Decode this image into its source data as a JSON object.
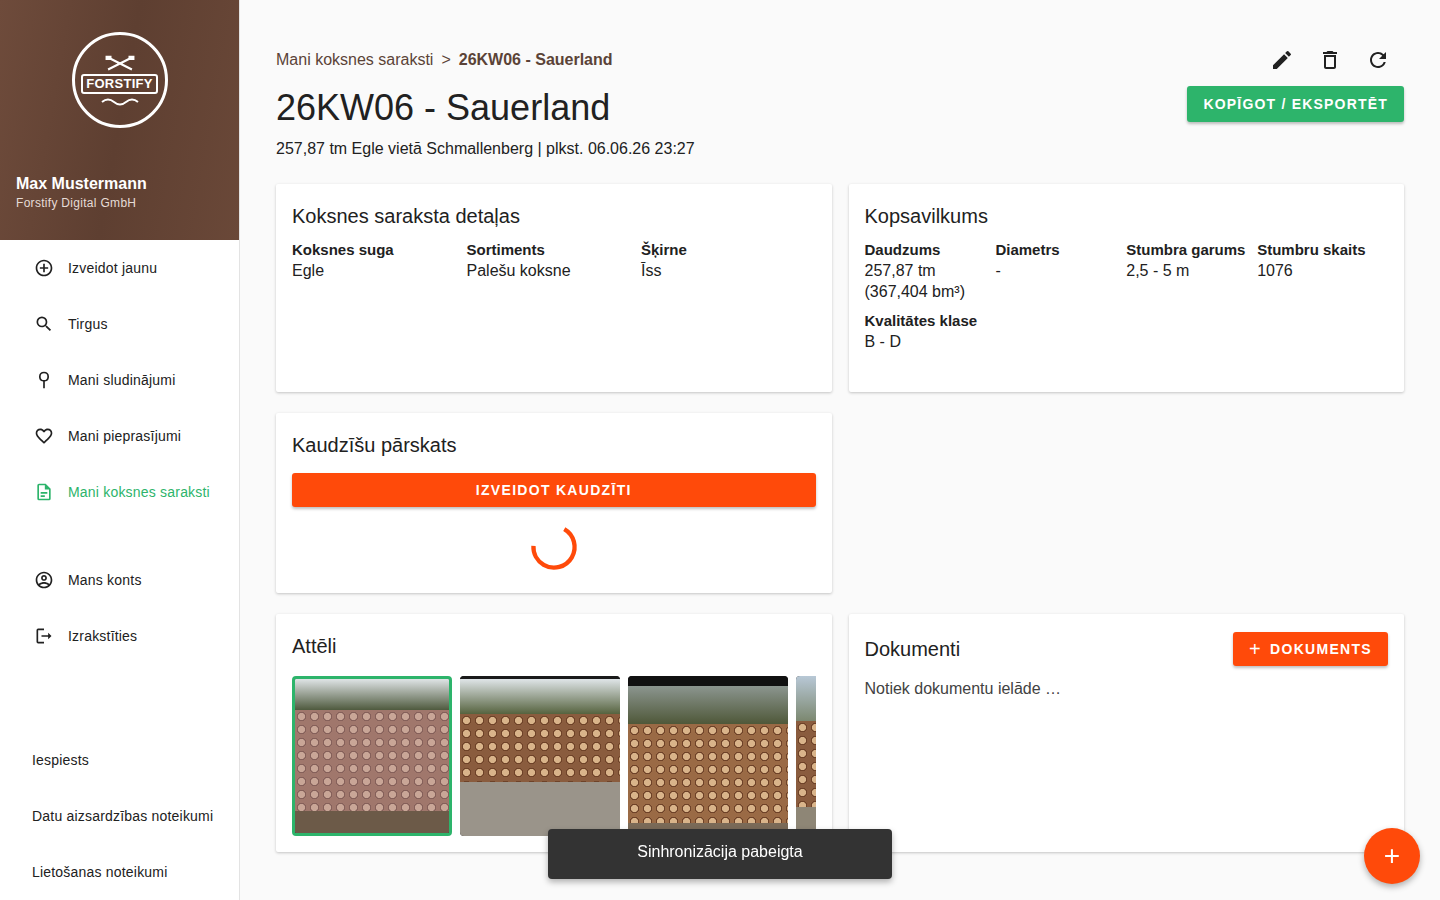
{
  "sidebar": {
    "logo": "FORSTIFY",
    "user": "Max Mustermann",
    "company": "Forstify Digital GmbH",
    "nav": [
      {
        "label": "Izveidot jaunu",
        "selected": false
      },
      {
        "label": "Tirgus",
        "selected": false
      },
      {
        "label": "Mani sludinājumi",
        "selected": false
      },
      {
        "label": "Mani pieprasījumi",
        "selected": false
      },
      {
        "label": "Mani koksnes saraksti",
        "selected": true
      }
    ],
    "account_nav": [
      {
        "label": "Mans konts",
        "selected": false
      },
      {
        "label": "Izrakstīties",
        "selected": false
      }
    ],
    "footer_links": [
      "Iespiests",
      "Datu aizsardzības noteikumi",
      "Lietošanas noteikumi"
    ]
  },
  "breadcrumb": {
    "parent": "Mani koksnes saraksti",
    "separator": ">",
    "current": "26KW06 - Sauerland"
  },
  "title": "26KW06 - Sauerland",
  "subtitle": "257,87 tm Egle vietā Schmallenberg | plkst. 06.06.26 23:27",
  "export_button": "KOPĪGOT / EKSPORTĒT",
  "details": {
    "title": "Koksnes saraksta detaļas",
    "fields": [
      {
        "label": "Koksnes suga",
        "values": [
          "Egle"
        ]
      },
      {
        "label": "Sortiments",
        "values": [
          "Palešu koksne"
        ]
      },
      {
        "label": "Šķirne",
        "values": [
          "Īss"
        ]
      }
    ]
  },
  "summary": {
    "title": "Kopsavilkums",
    "fields": [
      {
        "label": "Daudzums",
        "values": [
          "257,87 tm",
          "(367,404 bm³)"
        ]
      },
      {
        "label": "Diametrs",
        "values": [
          "-"
        ]
      },
      {
        "label": "Stumbra garums",
        "values": [
          "2,5 - 5 m"
        ]
      },
      {
        "label": "Stumbru skaits",
        "values": [
          "1076"
        ]
      },
      {
        "label": "Kvalitātes klase",
        "values": [
          "B - D"
        ]
      }
    ]
  },
  "piles": {
    "title": "Kaudzīšu pārskats",
    "button": "IZVEIDOT KAUDZĪTI",
    "loading": true
  },
  "images": {
    "title": "Attēli",
    "items": [
      {
        "selected": true
      },
      {
        "selected": false
      },
      {
        "selected": false
      },
      {
        "selected": false
      }
    ]
  },
  "documents": {
    "title": "Dokumenti",
    "button_icon": "+",
    "button": "DOKUMENTS",
    "status": "Notiek dokumentu ielāde …"
  },
  "toast": "Sinhronizācija pabeigta",
  "fab": "+"
}
